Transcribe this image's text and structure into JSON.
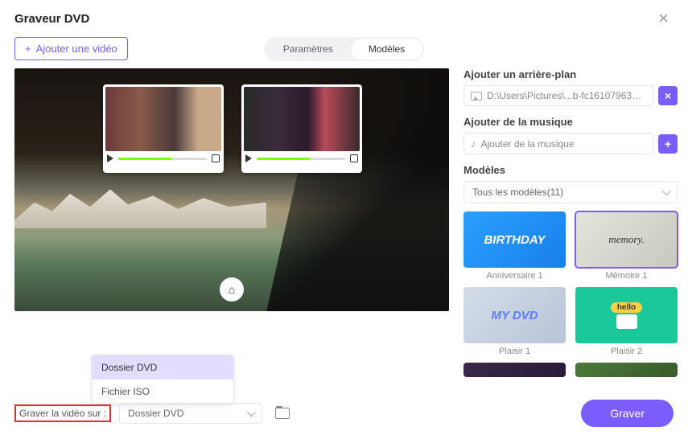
{
  "header": {
    "title": "Graveur DVD"
  },
  "toolbar": {
    "add_video": "Ajouter une vidéo",
    "tabs": {
      "settings": "Paramètres",
      "templates": "Modèles"
    }
  },
  "right": {
    "bg_label": "Ajouter un arrière-plan",
    "bg_path": "D:\\Users\\Pictures\\...b-fc1610796382.jpg",
    "music_label": "Ajouter de la musique",
    "music_placeholder": "Ajouter de la musique",
    "templates_label": "Modèles",
    "templates_select": "Tous les modèles(11)",
    "templates": [
      {
        "label": "Anniversaire 1",
        "text": "BIRTHDAY"
      },
      {
        "label": "Mémoire 1",
        "text": "memory."
      },
      {
        "label": "Plaisir 1",
        "text": "MY DVD"
      },
      {
        "label": "Plaisir 2",
        "text": "hello"
      }
    ]
  },
  "footer": {
    "burn_to_label": "Graver la vidéo sur :",
    "burn_select_value": "Dossier DVD",
    "burn_button": "Graver",
    "options": [
      "Dossier DVD",
      "Fichier ISO"
    ]
  }
}
